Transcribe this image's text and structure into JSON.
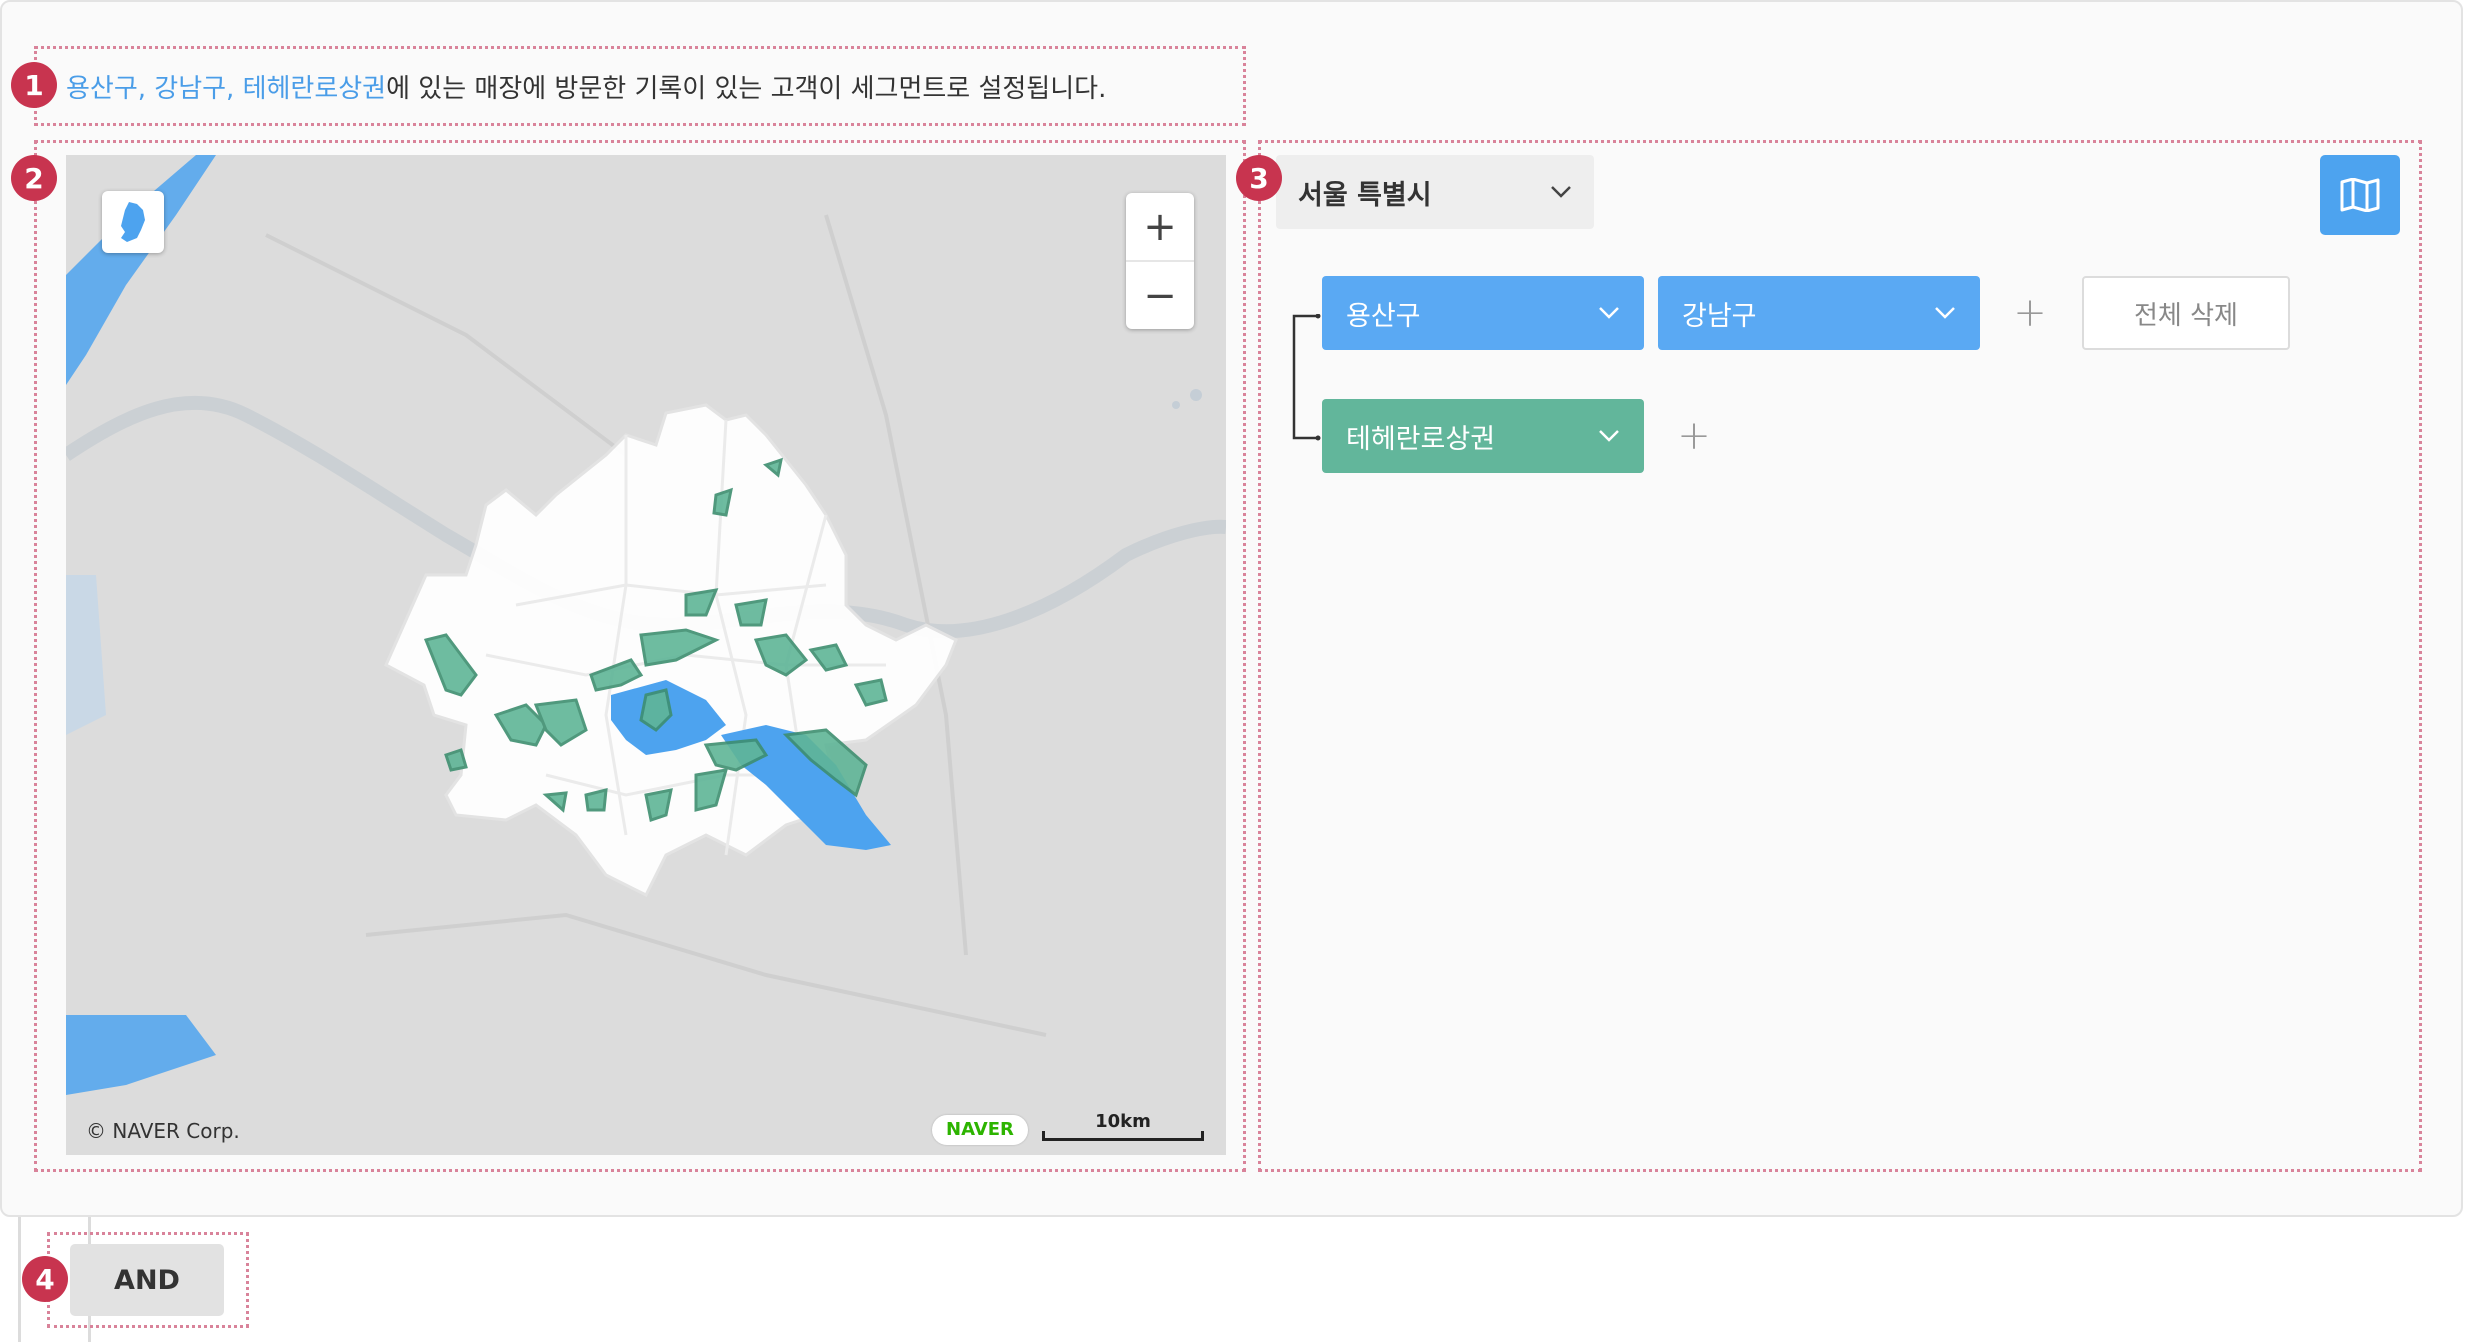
{
  "description": {
    "highlight": "용산구, 강남구, 테헤란로상권",
    "rest": "에 있는 매장에 방문한 기록이 있는 고객이 세그먼트로 설정됩니다."
  },
  "markers": [
    "1",
    "2",
    "3",
    "4"
  ],
  "map": {
    "zoom_in": "+",
    "zoom_out": "−",
    "copyright": "© NAVER Corp.",
    "brand": "NAVER",
    "scale_label": "10km",
    "colors": {
      "selected_district": "#4da3ef",
      "commercial_area": "#5fb597"
    }
  },
  "region": {
    "city": "서울 특별시",
    "districts": [
      {
        "label": "용산구",
        "color": "#5aa9f3"
      },
      {
        "label": "강남구",
        "color": "#5aa9f3"
      }
    ],
    "commercial_areas": [
      {
        "label": "테헤란로상권",
        "color": "#62b69b"
      }
    ],
    "add": "+",
    "delete_all": "전체 삭제"
  },
  "operator": "AND",
  "icons": {
    "city_dropdown": "chevron-down-icon",
    "map_toggle": "map-icon",
    "minimap": "korea-map-icon"
  }
}
